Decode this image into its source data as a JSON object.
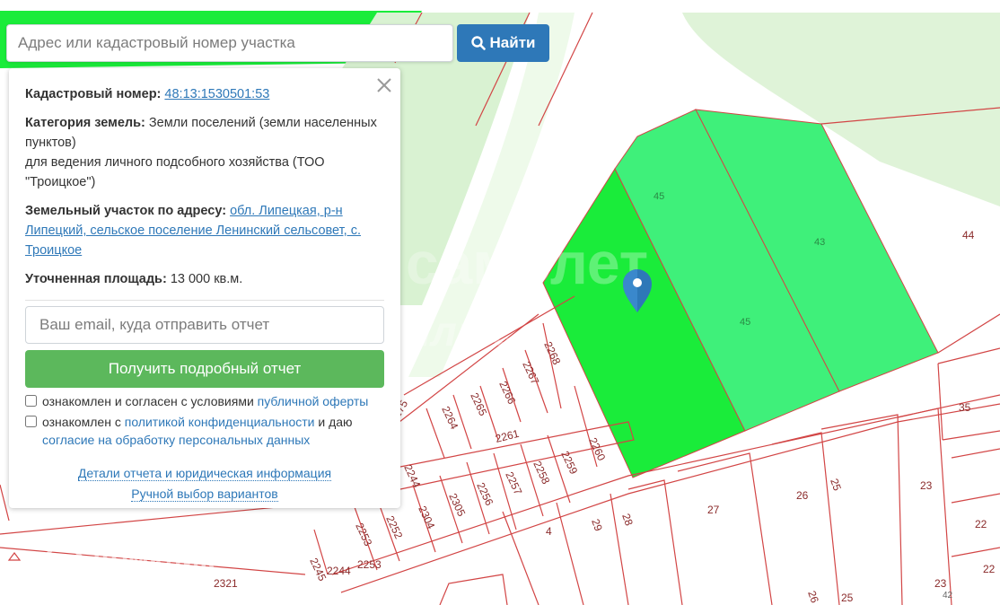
{
  "search": {
    "placeholder": "Адрес или кадастровый номер участка",
    "button_label": "Найти",
    "button_icon": "search-icon"
  },
  "info": {
    "cadastral_label": "Кадастровый номер:",
    "cadastral_value": "48:13:1530501:53",
    "category_label": "Категория земель:",
    "category_value": "Земли поселений (земли населенных пунктов)",
    "category_purpose": "для ведения личного подсобного хозяйства (ТОО \"Троицкое\")",
    "address_label": "Земельный участок по адресу:",
    "address_value": "обл. Липецкая, р-н Липецкий, сельское поселение Ленинский сельсовет, с. Троицкое",
    "area_label": "Уточненная площадь:",
    "area_value": "13 000 кв.м.",
    "email_placeholder": "Ваш email, куда отправить отчет",
    "report_button": "Получить подробный отчет",
    "consent1_text": "ознакомлен и согласен с условиями ",
    "consent1_link": "публичной оферты",
    "consent2_text1": "ознакомлен с ",
    "consent2_link1": "политикой конфиденциальности",
    "consent2_text2": " и даю ",
    "consent2_link2": "согласие на обработку персональных данных",
    "details_link": "Детали отчета и юридическая информация",
    "manual_link": "Ручной выбор вариантов"
  },
  "map": {
    "watermark_top": "самолет",
    "watermark_plus": "плюс",
    "watermark_bottom": "Домклик",
    "parcel_labels": [
      "45",
      "43",
      "44",
      "45",
      "2268",
      "2267",
      "2266",
      "2265",
      "2264",
      "2275",
      "2261",
      "2260",
      "2259",
      "2258",
      "2257",
      "2256",
      "2305",
      "2304",
      "2252",
      "2253",
      "2244",
      "2245",
      "2244",
      "2253",
      "2321",
      "4",
      "29",
      "28",
      "27",
      "26",
      "25",
      "35",
      "23",
      "22",
      "23",
      "42",
      "22",
      "25",
      "26"
    ],
    "colors": {
      "selected_parcel": "#1aec3a",
      "neighbor_parcel": "#3ff07a",
      "border": "#d24545",
      "marker": "#2e78b8"
    }
  }
}
